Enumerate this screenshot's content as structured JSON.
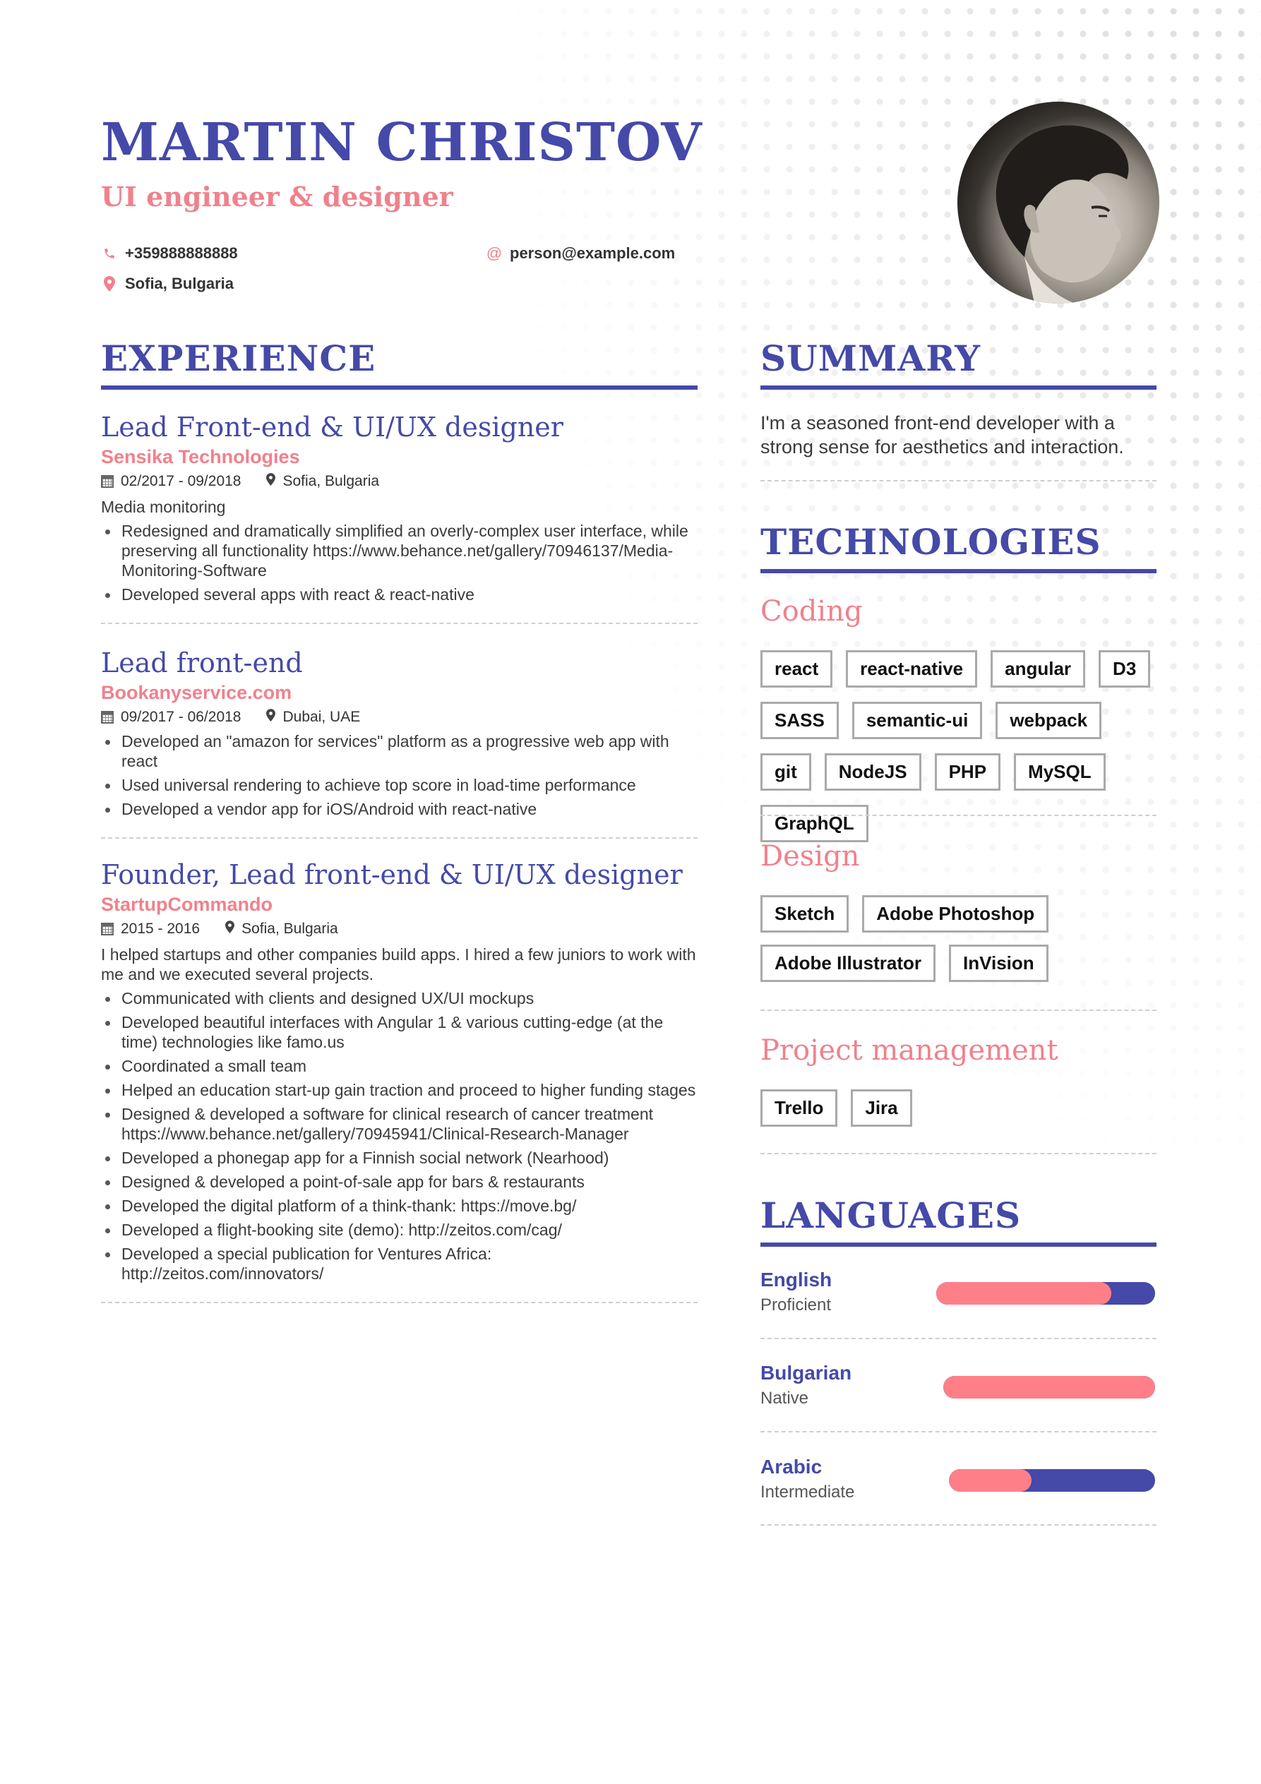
{
  "header": {
    "name": "MARTIN CHRISTOV",
    "subtitle": "UI engineer & designer",
    "phone": "+359888888888",
    "email": "person@example.com",
    "location": "Sofia, Bulgaria",
    "photo_alt": "Profile photo"
  },
  "colors": {
    "primary": "#4549a8",
    "accent": "#f0818c",
    "bar_fill": "#ff7f89"
  },
  "experience": {
    "title": "EXPERIENCE",
    "jobs": [
      {
        "title": "Lead Front-end & UI/UX designer",
        "company": "Sensika Technologies",
        "dates": "02/2017 - 09/2018",
        "location": "Sofia, Bulgaria",
        "description": "Media monitoring",
        "bullets": [
          "Redesigned and dramatically simplified an overly-complex user interface, while preserving all functionality https://www.behance.net/gallery/70946137/Media-Monitoring-Software",
          "Developed several apps with react & react-native"
        ]
      },
      {
        "title": "Lead front-end",
        "company": "Bookanyservice.com",
        "dates": "09/2017 - 06/2018",
        "location": "Dubai, UAE",
        "description": "",
        "bullets": [
          "Developed an \"amazon for services\" platform as a progressive web app with react",
          "Used universal rendering to achieve top score in load-time performance",
          "Developed a vendor app for iOS/Android with react-native"
        ]
      },
      {
        "title": "Founder, Lead front-end & UI/UX designer",
        "company": "StartupCommando",
        "dates": "2015 - 2016",
        "location": "Sofia, Bulgaria",
        "description": "I helped startups and other companies build apps. I hired a few juniors to work with me and we executed several projects.",
        "bullets": [
          "Communicated with clients and designed UX/UI mockups",
          "Developed beautiful interfaces with Angular 1 & various cutting-edge (at the time) technologies like famo.us",
          "Coordinated a small team",
          "Helped an education start-up gain traction and proceed to higher funding stages",
          "Designed & developed a software for clinical research of cancer treatment https://www.behance.net/gallery/70945941/Clinical-Research-Manager",
          "Developed a phonegap app for a Finnish social network (Nearhood)",
          "Designed & developed a point-of-sale app for bars & restaurants",
          "Developed the digital platform of a think-thank: https://move.bg/",
          "Developed a flight-booking site (demo): http://zeitos.com/cag/",
          "Developed a special publication for Ventures Africa: http://zeitos.com/innovators/"
        ]
      }
    ]
  },
  "summary": {
    "title": "SUMMARY",
    "text": "I'm a seasoned front-end developer with a strong sense for aesthetics and interaction."
  },
  "technologies": {
    "title": "TECHNOLOGIES",
    "groups": [
      {
        "name": "Coding",
        "tags": [
          "react",
          "react-native",
          "angular",
          "D3",
          "SASS",
          "semantic-ui",
          "webpack",
          "git",
          "NodeJS",
          "PHP",
          "MySQL",
          "GraphQL"
        ]
      },
      {
        "name": "Design",
        "tags": [
          "Sketch",
          "Adobe Photoshop",
          "Adobe Illustrator",
          "InVision"
        ]
      },
      {
        "name": "Project management",
        "tags": [
          "Trello",
          "Jira"
        ]
      }
    ]
  },
  "languages": {
    "title": "LANGUAGES",
    "items": [
      {
        "name": "English",
        "level": "Proficient",
        "proficiency": 0.8
      },
      {
        "name": "Bulgarian",
        "level": "Native",
        "proficiency": 1.0
      },
      {
        "name": "Arabic",
        "level": "Intermediate",
        "proficiency": 0.4
      }
    ]
  }
}
